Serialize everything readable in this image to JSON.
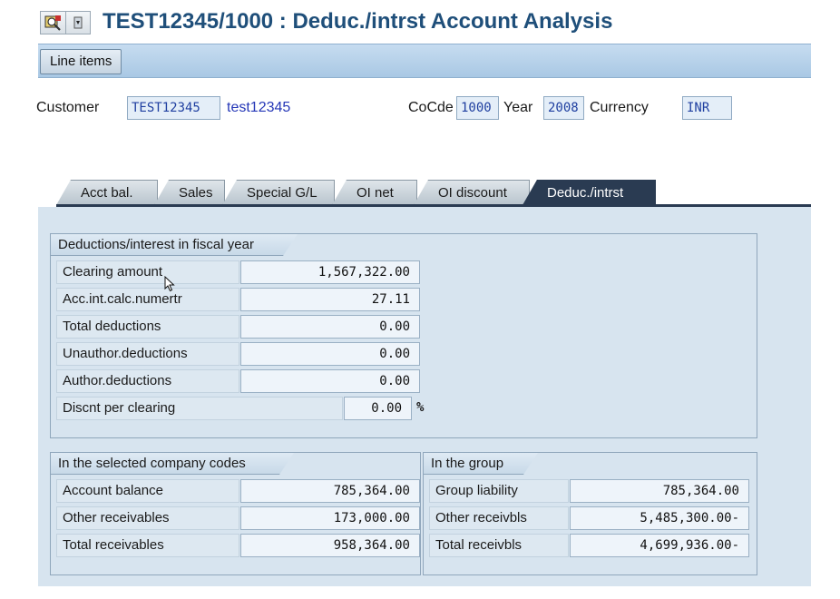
{
  "window": {
    "title": "TEST12345/1000 : Deduc./intrst Account Analysis"
  },
  "toolbar": {
    "line_items_label": "Line items"
  },
  "header": {
    "customer_label": "Customer",
    "customer_id": "TEST12345",
    "customer_name": "test12345",
    "cocde_label": "CoCde",
    "cocde_value": "1000",
    "year_label": "Year",
    "year_value": "2008",
    "currency_label": "Currency",
    "currency_value": "INR"
  },
  "tabs": [
    {
      "label": "Acct bal."
    },
    {
      "label": "Sales"
    },
    {
      "label": "Special G/L"
    },
    {
      "label": "OI net"
    },
    {
      "label": "OI discount"
    },
    {
      "label": "Deduc./intrst",
      "active": true
    }
  ],
  "deductions": {
    "title": "Deductions/interest in fiscal year",
    "rows": [
      {
        "label": "Clearing amount",
        "value": "1,567,322.00"
      },
      {
        "label": "Acc.int.calc.numertr",
        "value": "27.11"
      },
      {
        "label": "Total deductions",
        "value": "0.00"
      },
      {
        "label": "Unauthor.deductions",
        "value": "0.00"
      },
      {
        "label": "Author.deductions",
        "value": "0.00"
      },
      {
        "label": "Discnt per clearing",
        "value": "0.00",
        "suffix": "%"
      }
    ]
  },
  "company_codes": {
    "title": "In the selected company codes",
    "rows": [
      {
        "label": "Account balance",
        "value": "785,364.00"
      },
      {
        "label": "Other receivables",
        "value": "173,000.00"
      },
      {
        "label": "Total receivables",
        "value": "958,364.00"
      }
    ]
  },
  "group": {
    "title": "In the group",
    "rows": [
      {
        "label": "Group liability",
        "value": "785,364.00"
      },
      {
        "label": "Other receivbls",
        "value": "5,485,300.00-"
      },
      {
        "label": "Total receivbls",
        "value": "4,699,936.00-"
      }
    ]
  },
  "colors": {
    "title_text": "#1f4f7a",
    "toolbar_bg": "#a9c8e4",
    "content_bg": "#d7e4ef",
    "active_tab": "#2a3b52",
    "field_text": "#1f3fa0"
  },
  "icons": [
    "display-change-icon",
    "dropdown-arrow-icon",
    "mouse-cursor-icon"
  ]
}
